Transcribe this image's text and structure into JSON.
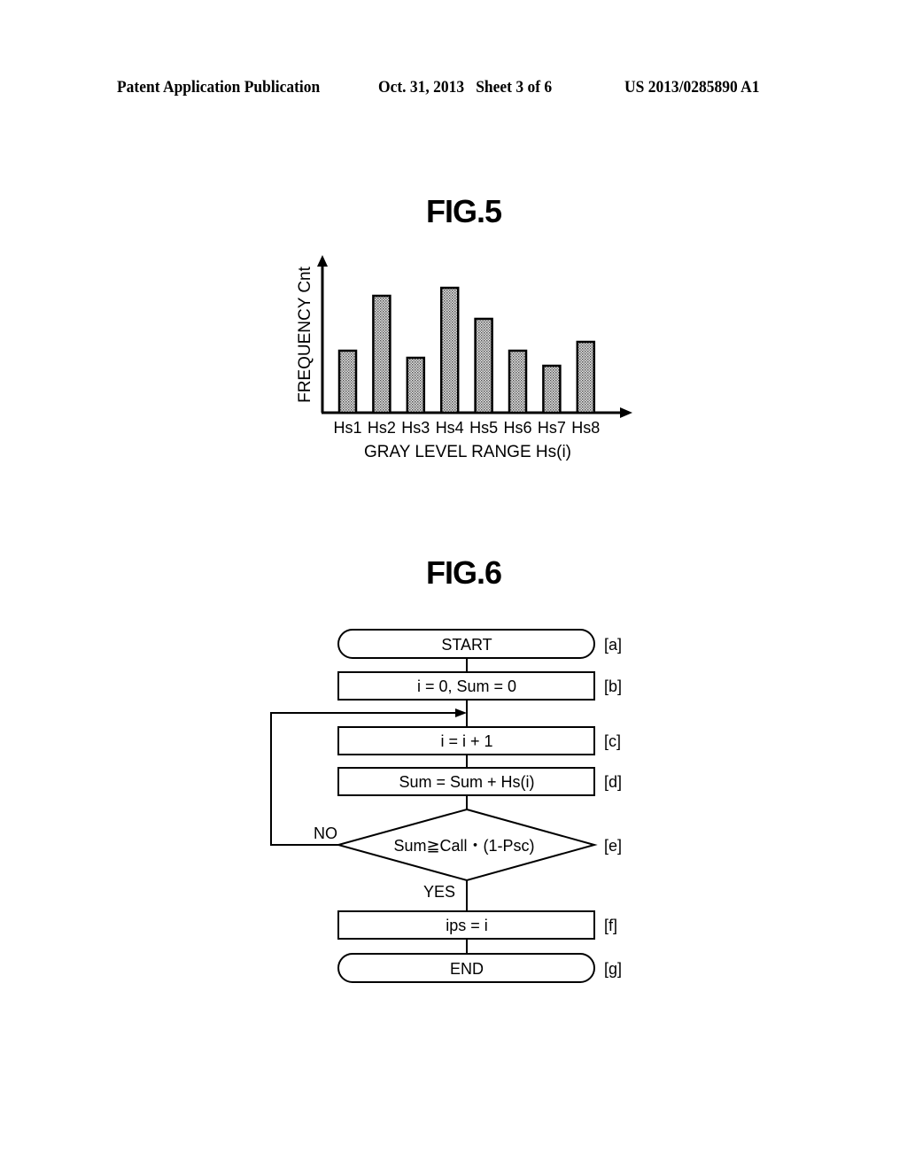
{
  "header": {
    "left": "Patent Application Publication",
    "middle": "Oct. 31, 2013   Sheet 3 of 6",
    "right": "US 2013/0285890 A1"
  },
  "fig5": {
    "title": "FIG.5"
  },
  "chart_data": {
    "type": "bar",
    "title": "FIG.5",
    "categories": [
      "Hs1",
      "Hs2",
      "Hs3",
      "Hs4",
      "Hs5",
      "Hs6",
      "Hs7",
      "Hs8"
    ],
    "values": [
      70,
      132,
      62,
      141,
      106,
      70,
      53,
      80
    ],
    "value_note": "relative heights in arbitrary units (no axis ticks shown)",
    "xlabel": "GRAY LEVEL RANGE Hs(i)",
    "ylabel": "FREQUENCY Cnt",
    "ylim": [
      0,
      176
    ],
    "grid": false,
    "bar_fill": "dotted-gray"
  },
  "fig6": {
    "title": "FIG.6",
    "steps": [
      {
        "id": "a",
        "label": "[a]",
        "text": "START",
        "shape": "terminal"
      },
      {
        "id": "b",
        "label": "[b]",
        "text": "i = 0, Sum = 0",
        "shape": "process"
      },
      {
        "id": "c",
        "label": "[c]",
        "text": "i = i + 1",
        "shape": "process"
      },
      {
        "id": "d",
        "label": "[d]",
        "text": "Sum = Sum + Hs(i)",
        "shape": "process"
      },
      {
        "id": "e",
        "label": "[e]",
        "text": "Sum≧Call・(1-Psc)",
        "shape": "decision"
      },
      {
        "id": "f",
        "label": "[f]",
        "text": "ips = i",
        "shape": "process"
      },
      {
        "id": "g",
        "label": "[g]",
        "text": "END",
        "shape": "terminal"
      }
    ],
    "no_label": "NO",
    "yes_label": "YES"
  }
}
